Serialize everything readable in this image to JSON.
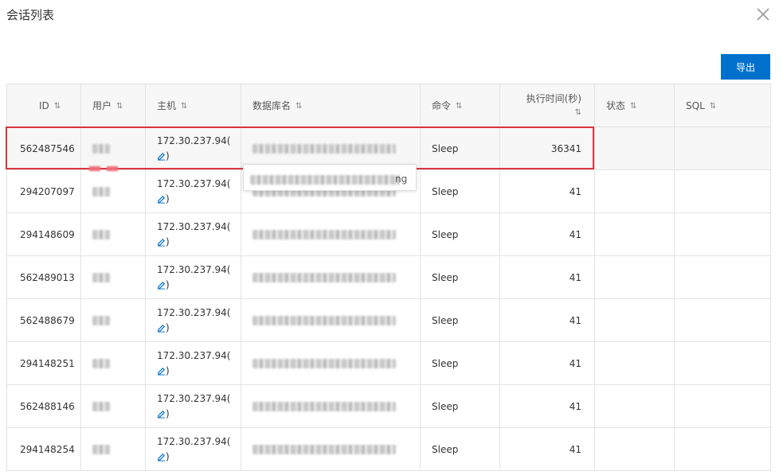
{
  "dialog": {
    "title": "会话列表"
  },
  "toolbar": {
    "export_label": "导出"
  },
  "table": {
    "columns": {
      "id": "ID",
      "user": "用户",
      "host": "主机",
      "db": "数据库名",
      "command": "命令",
      "time": "执行时间(秒)",
      "state": "状态",
      "sql": "SQL"
    },
    "rows": [
      {
        "id": "562487546",
        "host": "172.30.237.94(",
        "host_close": ")",
        "command": "Sleep",
        "time": "36341"
      },
      {
        "id": "294207097",
        "host": "172.30.237.94(",
        "host_close": ")",
        "command": "Sleep",
        "time": "41"
      },
      {
        "id": "294148609",
        "host": "172.30.237.94(",
        "host_close": ")",
        "command": "Sleep",
        "time": "41"
      },
      {
        "id": "562489013",
        "host": "172.30.237.94(",
        "host_close": ")",
        "command": "Sleep",
        "time": "41"
      },
      {
        "id": "562488679",
        "host": "172.30.237.94(",
        "host_close": ")",
        "command": "Sleep",
        "time": "41"
      },
      {
        "id": "294148251",
        "host": "172.30.237.94(",
        "host_close": ")",
        "command": "Sleep",
        "time": "41"
      },
      {
        "id": "562488146",
        "host": "172.30.237.94(",
        "host_close": ")",
        "command": "Sleep",
        "time": "41"
      },
      {
        "id": "294148254",
        "host": "172.30.237.94(",
        "host_close": ")",
        "command": "Sleep",
        "time": "41"
      }
    ]
  },
  "tooltip": {
    "tail_text": "ng"
  },
  "colors": {
    "accent": "#0070cc",
    "highlight": "#d9363e"
  },
  "icons": {
    "close": "close-icon",
    "sort": "sort-icon",
    "edit": "edit-icon"
  }
}
